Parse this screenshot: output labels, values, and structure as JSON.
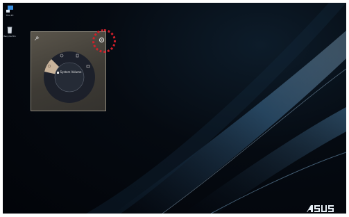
{
  "desktop": {
    "icons": [
      {
        "label": "This PC",
        "icon": "computer-icon"
      },
      {
        "label": "Recycle Bin",
        "icon": "recycle-bin-icon"
      }
    ],
    "brand_logo_text": "/ISUS"
  },
  "widget": {
    "center_label": "System Volume",
    "pin_icon": "pin-icon",
    "settings_icon": "gear-icon",
    "wheel_icons": [
      "brightness-icon",
      "sound-icon",
      "display-icon",
      "selected-mode-icon"
    ],
    "highlight_color": "#d01f2a"
  }
}
